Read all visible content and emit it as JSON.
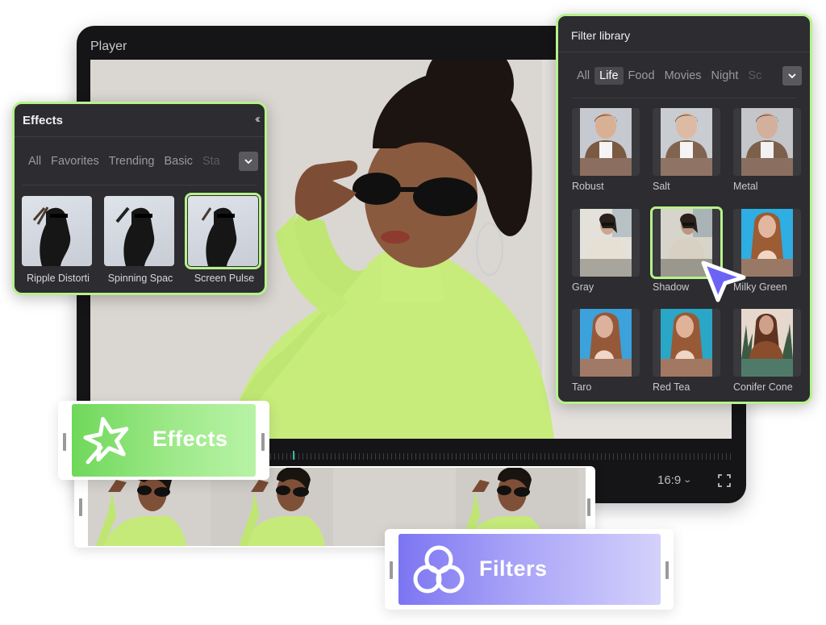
{
  "player": {
    "title": "Player",
    "aspect_ratio": "16:9",
    "aspect_ratio_chevron": "⌄",
    "playhead_color": "#2fb9a4"
  },
  "effects_panel": {
    "title": "Effects",
    "collapse_glyph": "‹‹",
    "tabs": [
      {
        "label": "All",
        "active": false
      },
      {
        "label": "Favorites",
        "active": false
      },
      {
        "label": "Trending",
        "active": false
      },
      {
        "label": "Basic",
        "active": false
      },
      {
        "label": "Sta",
        "active": false
      }
    ],
    "items": [
      {
        "label": "Ripple Distorti",
        "selected": false
      },
      {
        "label": "Spinning Spac",
        "selected": false
      },
      {
        "label": "Screen Pulse",
        "selected": true
      }
    ]
  },
  "filter_panel": {
    "title": "Filter library",
    "tabs": [
      {
        "label": "All",
        "active": false
      },
      {
        "label": "Life",
        "active": true
      },
      {
        "label": "Food",
        "active": false
      },
      {
        "label": "Movies",
        "active": false
      },
      {
        "label": "Night",
        "active": false
      },
      {
        "label": "Sc",
        "active": false
      }
    ],
    "items": [
      {
        "label": "Robust",
        "selected": false
      },
      {
        "label": "Salt",
        "selected": false
      },
      {
        "label": "Metal",
        "selected": false
      },
      {
        "label": "Gray",
        "selected": false
      },
      {
        "label": "Shadow",
        "selected": true
      },
      {
        "label": "Milky Green",
        "selected": false
      },
      {
        "label": "Taro",
        "selected": false
      },
      {
        "label": "Red Tea",
        "selected": false
      },
      {
        "label": "Conifer Cone",
        "selected": false
      }
    ]
  },
  "chips": {
    "effects_label": "Effects",
    "filters_label": "Filters"
  },
  "colors": {
    "accent_green": "#b6f28a",
    "panel_bg": "#2d2c30",
    "cursor": "#6c63f5",
    "effects_gradient_start": "#6fd85a",
    "filters_gradient_start": "#7c75f2"
  }
}
